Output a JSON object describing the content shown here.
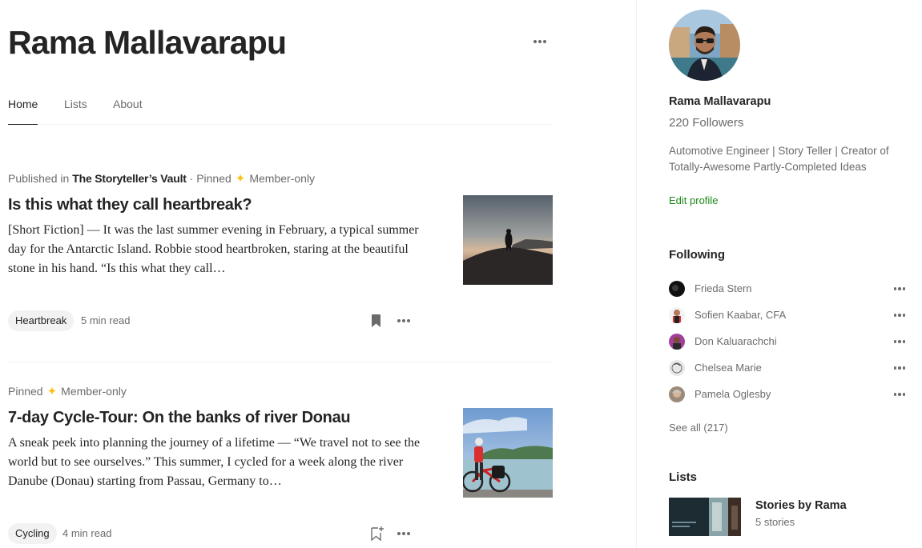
{
  "profile": {
    "name": "Rama Mallavarapu"
  },
  "tabs": [
    {
      "label": "Home"
    },
    {
      "label": "Lists"
    },
    {
      "label": "About"
    }
  ],
  "articles": [
    {
      "published_in_prefix": "Published in",
      "publication": "The Storyteller’s Vault",
      "separator": " · ",
      "pinned": "Pinned",
      "member_only": "Member-only",
      "title": "Is this what they call heartbreak?",
      "excerpt": "[Short Fiction] — It was the last summer evening in February, a typical summer day for the Antarctic Island. Robbie stood heartbroken, staring at the beautiful stone in his hand. “Is this what they call…",
      "tag": "Heartbreak",
      "read_time": "5 min read",
      "bookmarked": true
    },
    {
      "pinned": "Pinned",
      "member_only": "Member-only",
      "title": "7-day Cycle-Tour: On the banks of river Donau",
      "excerpt": "A sneak peek into planning the journey of a lifetime — “We travel not to see the world but to see ourselves.” This summer, I cycled for a week along the river Danube (Donau) starting from Passau, Germany to…",
      "tag": "Cycling",
      "read_time": "4 min read",
      "bookmarked": false
    }
  ],
  "sidebar": {
    "name": "Rama Mallavarapu",
    "followers": "220 Followers",
    "bio": "Automotive Engineer | Story Teller | Creator of Totally-Awesome Partly-Completed Ideas",
    "edit_profile": "Edit profile",
    "following_heading": "Following",
    "following": [
      {
        "name": "Frieda Stern"
      },
      {
        "name": "Sofien Kaabar, CFA"
      },
      {
        "name": "Don Kaluarachchi"
      },
      {
        "name": "Chelsea Marie"
      },
      {
        "name": "Pamela Oglesby"
      }
    ],
    "see_all": "See all (217)",
    "lists_heading": "Lists",
    "list": {
      "title": "Stories by Rama",
      "count": "5 stories"
    }
  },
  "colors": {
    "accent_green": "#1a8917",
    "star_gold": "#ffc017",
    "text_primary": "#242424",
    "text_secondary": "#6b6b6b"
  }
}
